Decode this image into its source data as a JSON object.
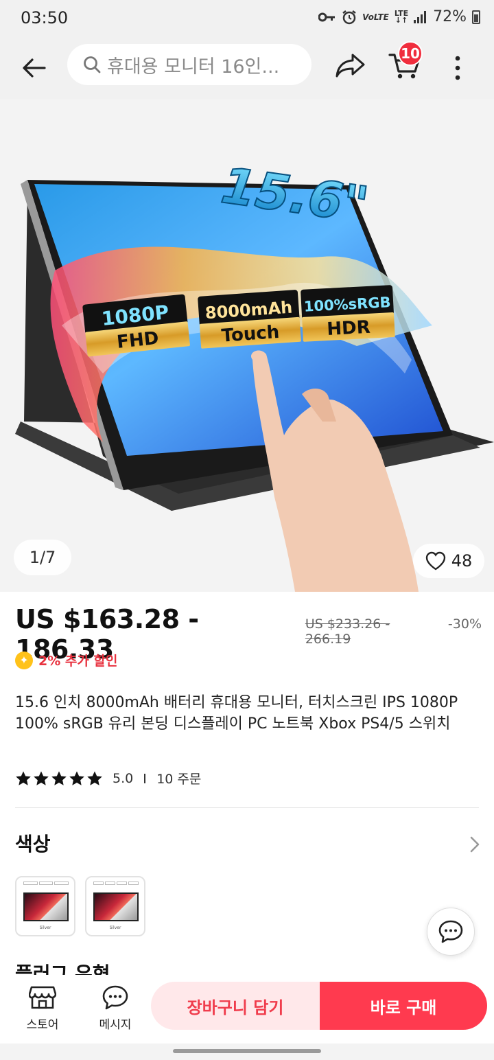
{
  "status_bar": {
    "time": "03:50",
    "battery": "72%",
    "network_volte": "VoLTE",
    "network_lte": "LTE"
  },
  "header": {
    "search_placeholder": "휴대용 모니터 16인...",
    "cart_count": "10"
  },
  "hero": {
    "page_indicator": "1/7",
    "wishlist_count": "48",
    "size_label": "15.6\"",
    "badges": [
      {
        "line1": "1080P",
        "line2": "FHD"
      },
      {
        "line1": "8000mAh",
        "line2": "Touch"
      },
      {
        "line1": "100%sRGB",
        "line2": "HDR"
      }
    ]
  },
  "price": {
    "current": "US $163.28 - 186.33",
    "original": "US $233.26 - 266.19",
    "discount": "-30%",
    "extra_discount": "2% 추가 할인"
  },
  "product": {
    "title": "15.6 인치 8000mAh 배터리 휴대용 모니터, 터치스크린 IPS 1080P 100% sRGB 유리 본딩 디스플레이 PC 노트북 Xbox PS4/5 스위치",
    "rating": "5.0",
    "orders": "10 주문"
  },
  "color_section": {
    "title": "색상",
    "swatch_label": "Silver"
  },
  "next_section_title": "플러그 유형",
  "bottom_bar": {
    "store_label": "스토어",
    "message_label": "메시지",
    "add_to_cart": "장바구니 담기",
    "buy_now": "바로 구매"
  },
  "colors": {
    "accent": "#ff3a4f",
    "accent_light": "#ffe8ea",
    "badge": "#f02d3d",
    "star": "#111111",
    "coin": "#ffc21a"
  }
}
